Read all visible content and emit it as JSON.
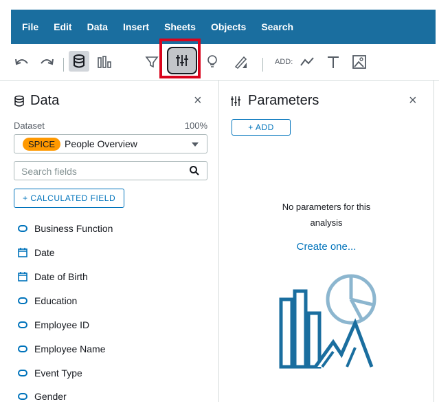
{
  "menu": [
    "File",
    "Edit",
    "Data",
    "Insert",
    "Sheets",
    "Objects",
    "Search"
  ],
  "toolbar": {
    "add_label": "ADD:",
    "icons": [
      "undo-icon",
      "redo-icon",
      "dataset-icon",
      "visuals-icon",
      "filter-icon",
      "parameters-icon",
      "insights-icon",
      "themes-icon",
      "add-line-chart-icon",
      "add-text-icon",
      "add-image-icon"
    ],
    "highlight_color": "#d9041c"
  },
  "data_panel": {
    "title": "Data",
    "close": "×",
    "dataset_label": "Dataset",
    "dataset_percent": "100%",
    "spice_badge": "SPICE",
    "dataset_name": "People Overview",
    "search_placeholder": "Search fields",
    "calculated_field_button": "+  CALCULATED FIELD",
    "fields": [
      {
        "name": "Business Function",
        "icon": "string-field-icon"
      },
      {
        "name": "Date",
        "icon": "date-field-icon"
      },
      {
        "name": "Date of Birth",
        "icon": "date-field-icon"
      },
      {
        "name": "Education",
        "icon": "string-field-icon"
      },
      {
        "name": "Employee ID",
        "icon": "string-field-icon"
      },
      {
        "name": "Employee Name",
        "icon": "string-field-icon"
      },
      {
        "name": "Event Type",
        "icon": "string-field-icon"
      },
      {
        "name": "Gender",
        "icon": "string-field-icon"
      }
    ]
  },
  "parameters_panel": {
    "title": "Parameters",
    "close": "×",
    "add_button": "+  ADD",
    "empty_line1": "No parameters for this",
    "empty_line2": "analysis",
    "create_link": "Create one..."
  },
  "colors": {
    "menubar": "#1a6e9f",
    "accent": "#0073bb",
    "spice": "#ff9900",
    "illustration": "#1a6e9f",
    "illustration_light": "#8cb6cf"
  }
}
